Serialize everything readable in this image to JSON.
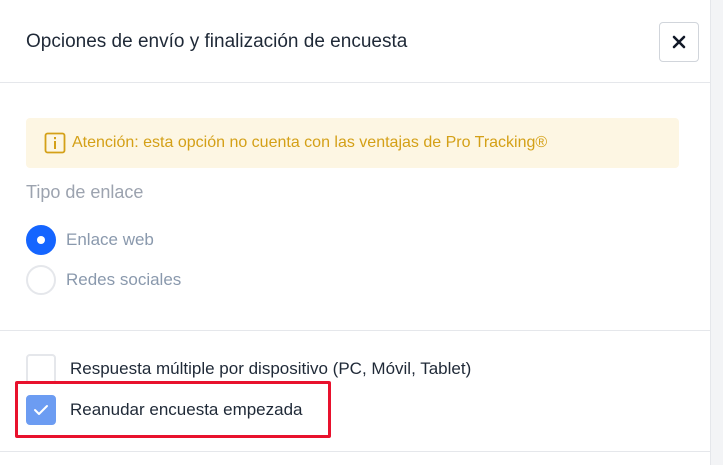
{
  "modal": {
    "title": "Opciones de envío y finalización de encuesta",
    "close_icon": "close-icon"
  },
  "alert": {
    "icon": "info-icon",
    "text": "Atención: esta opción no cuenta con las ventajas de Pro Tracking®",
    "color": "#d4a017",
    "background": "#fdf6e3"
  },
  "link_type": {
    "title": "Tipo de enlace",
    "options": [
      {
        "label": "Enlace web",
        "selected": true
      },
      {
        "label": "Redes sociales",
        "selected": false
      }
    ],
    "accent": "#1565ff"
  },
  "options": [
    {
      "label": "Respuesta múltiple por dispositivo (PC, Móvil, Tablet)",
      "checked": false
    },
    {
      "label": "Reanudar encuesta empezada",
      "checked": true
    }
  ],
  "highlight_color": "#e8112d"
}
